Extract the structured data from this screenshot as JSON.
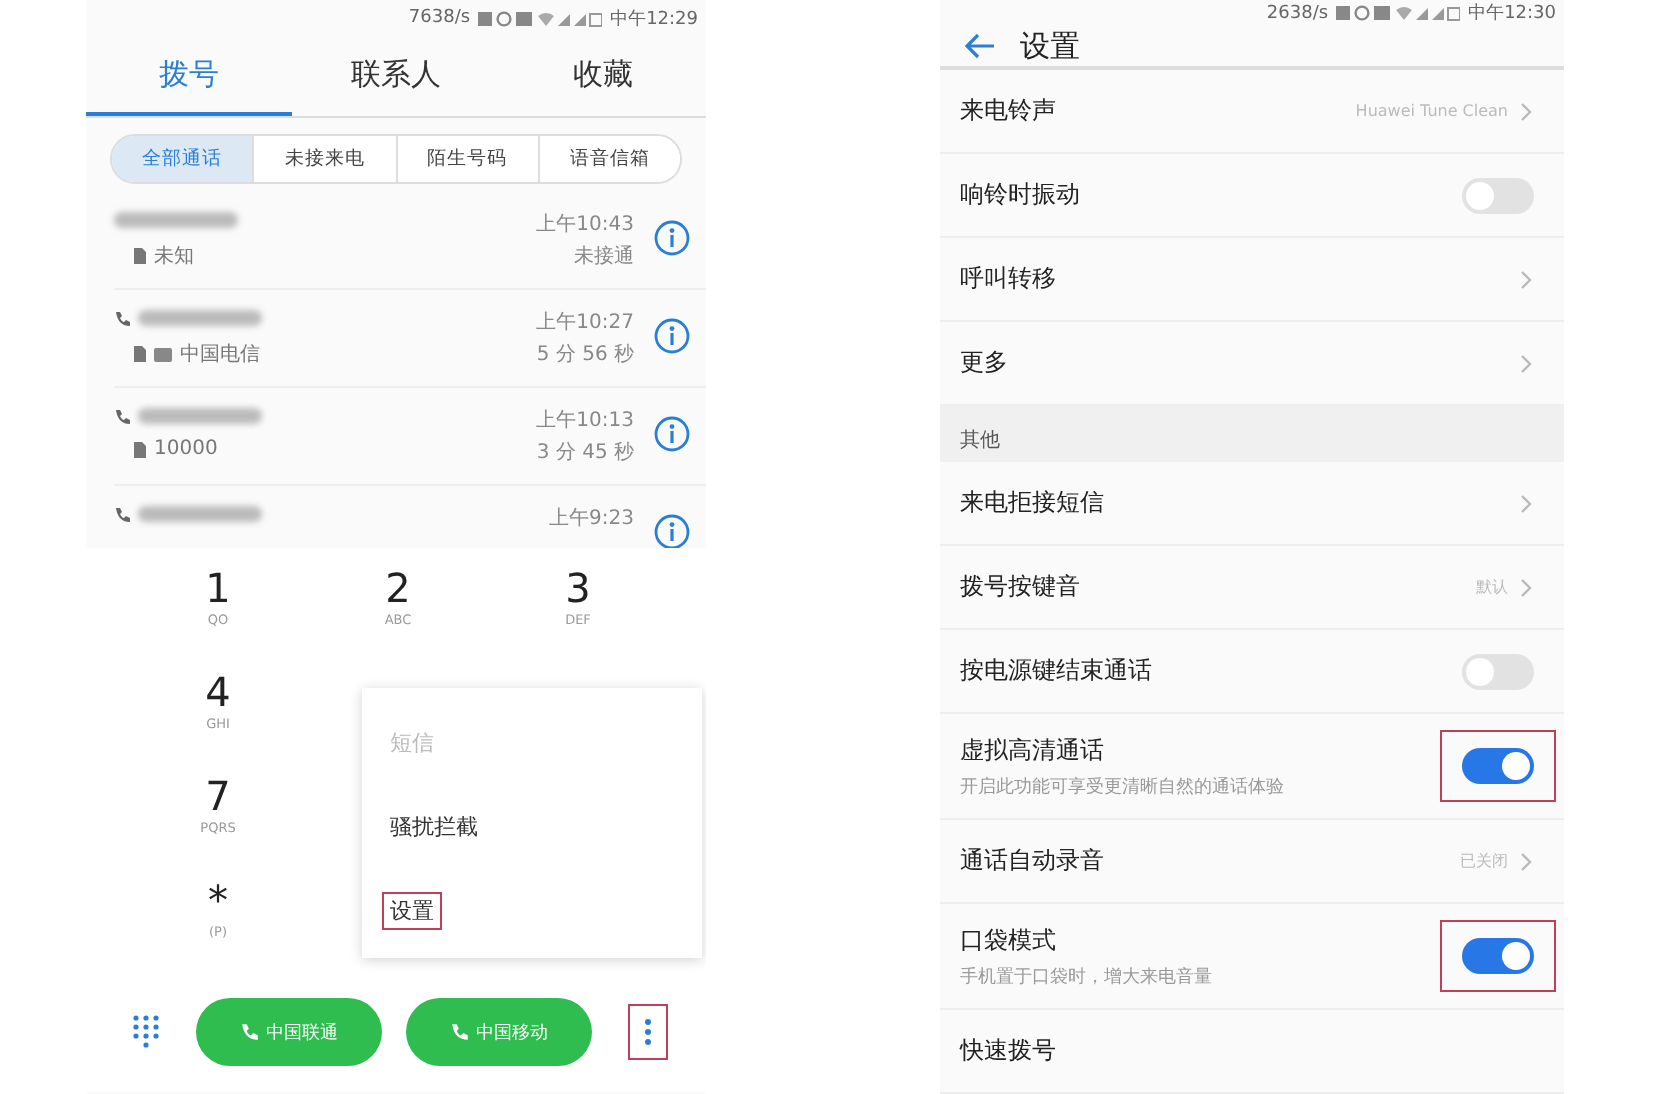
{
  "dialer": {
    "status": {
      "speed": "7638/s",
      "time": "中午12:29"
    },
    "tabs": [
      {
        "label": "拨号",
        "selected": true
      },
      {
        "label": "联系人",
        "selected": false
      },
      {
        "label": "收藏",
        "selected": false
      }
    ],
    "filters": [
      {
        "label": "全部通话",
        "selected": true
      },
      {
        "label": "未接来电",
        "selected": false
      },
      {
        "label": "陌生号码",
        "selected": false
      },
      {
        "label": "语音信箱",
        "selected": false
      }
    ],
    "calls": [
      {
        "call_icon": false,
        "hd": false,
        "detail": "未知",
        "time": "上午10:43",
        "info": "未接通"
      },
      {
        "call_icon": true,
        "hd": true,
        "detail": "中国电信",
        "time": "上午10:27",
        "info": "5 分 56 秒"
      },
      {
        "call_icon": true,
        "hd": false,
        "detail": "10000",
        "time": "上午10:13",
        "info": "3 分 45 秒"
      },
      {
        "call_icon": true,
        "hd": false,
        "time": "上午9:23"
      }
    ],
    "keypad": [
      [
        {
          "digit": "1",
          "letters": "QO"
        },
        {
          "digit": "2",
          "letters": "ABC"
        },
        {
          "digit": "3",
          "letters": "DEF"
        }
      ],
      [
        {
          "digit": "4",
          "letters": "GHI"
        }
      ],
      [
        {
          "digit": "7",
          "letters": "PQRS"
        }
      ],
      [
        {
          "digit": "*",
          "letters": "(P)"
        }
      ]
    ],
    "menu": [
      {
        "label": "短信",
        "disabled": true,
        "highlighted": false
      },
      {
        "label": "骚扰拦截",
        "disabled": false,
        "highlighted": false
      },
      {
        "label": "设置",
        "disabled": false,
        "highlighted": true
      }
    ],
    "sim_buttons": [
      {
        "label": "中国联通"
      },
      {
        "label": "中国移动"
      }
    ],
    "more_button": {
      "highlighted": true
    }
  },
  "settings": {
    "status": {
      "speed": "2638/s",
      "time": "中午12:30"
    },
    "title": "设置",
    "items": [
      {
        "kind": "link",
        "label": "来电铃声",
        "value": "Huawei Tune Clean"
      },
      {
        "kind": "toggle",
        "label": "响铃时振动",
        "on": false,
        "highlighted": false
      },
      {
        "kind": "link",
        "label": "呼叫转移"
      },
      {
        "kind": "link",
        "label": "更多"
      },
      {
        "kind": "header",
        "label": "其他"
      },
      {
        "kind": "link",
        "label": "来电拒接短信"
      },
      {
        "kind": "link",
        "label": "拨号按键音",
        "value": "默认"
      },
      {
        "kind": "toggle",
        "label": "按电源键结束通话",
        "on": false,
        "highlighted": false
      },
      {
        "kind": "toggle",
        "label": "虚拟高清通话",
        "sub": "开启此功能可享受更清晰自然的通话体验",
        "on": true,
        "highlighted": true
      },
      {
        "kind": "link",
        "label": "通话自动录音",
        "value": "已关闭"
      },
      {
        "kind": "toggle",
        "label": "口袋模式",
        "sub": "手机置于口袋时，增大来电音量",
        "on": true,
        "highlighted": true
      },
      {
        "kind": "plain",
        "label": "快速拨号"
      }
    ]
  }
}
